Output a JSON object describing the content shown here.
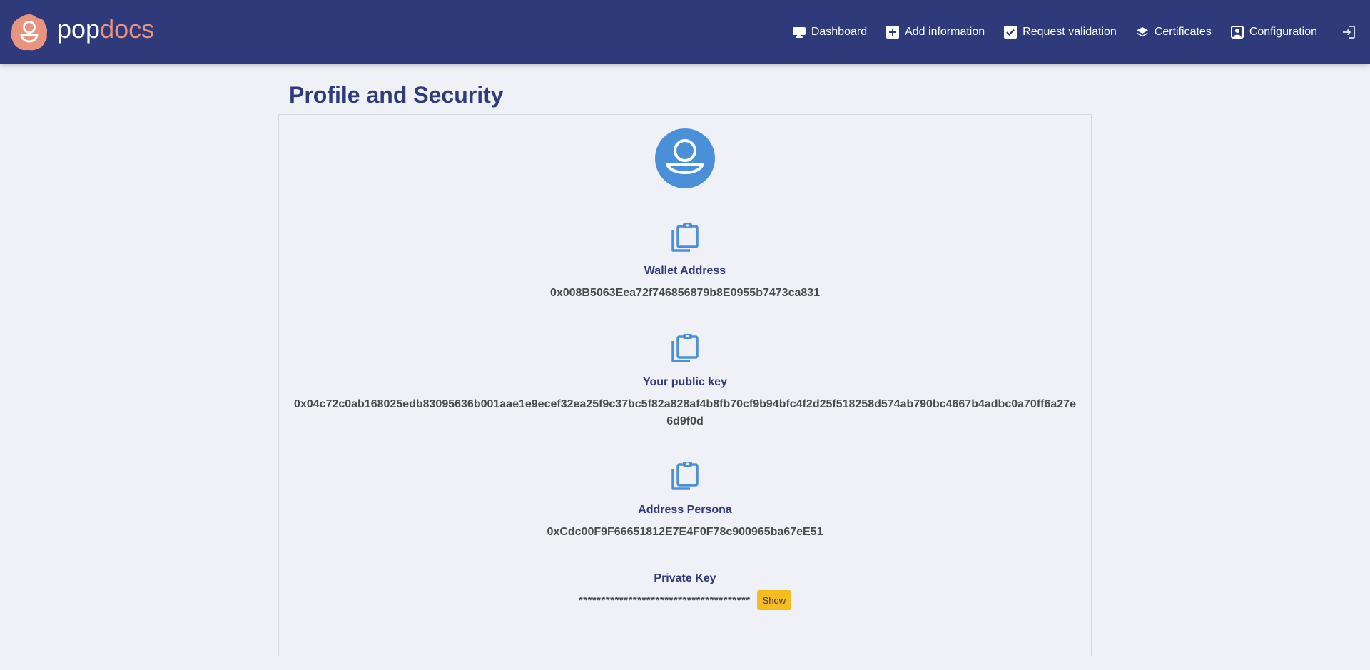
{
  "brand": {
    "name_part1": "pop",
    "name_part2": "docs",
    "colors": {
      "primary": "#2e3a7a",
      "accent": "#e9947f"
    }
  },
  "nav": {
    "items": [
      {
        "label": "Dashboard",
        "icon": "monitor-icon"
      },
      {
        "label": "Add information",
        "icon": "plus-square-icon"
      },
      {
        "label": "Request validation",
        "icon": "check-square-icon"
      },
      {
        "label": "Certificates",
        "icon": "layers-icon"
      },
      {
        "label": "Configuration",
        "icon": "user-square-icon"
      }
    ],
    "logout_icon": "logout-icon"
  },
  "page": {
    "title": "Profile and Security"
  },
  "profile": {
    "avatar_icon": "user-circle-icon",
    "wallet": {
      "label": "Wallet Address",
      "value": "0x008B5063Eea72f746856879b8E0955b7473ca831",
      "icon": "clipboard-icon"
    },
    "public_key": {
      "label": "Your public key",
      "value": "0x04c72c0ab168025edb83095636b001aae1e9ecef32ea25f9c37bc5f82a828af4b8fb70cf9b94bfc4f2d25f518258d574ab790bc4667b4adbc0a70ff6a27e6d9f0d",
      "icon": "clipboard-icon"
    },
    "persona": {
      "label": "Address Persona",
      "value": "0xCdc00F9F66651812E7E4F0F78c900965ba67eE51",
      "icon": "clipboard-icon"
    },
    "private_key": {
      "label": "Private Key",
      "masked_value": "**************************************",
      "show_label": "Show"
    },
    "colors": {
      "icon": "#4a90d9",
      "button": "#f5bd1f"
    }
  }
}
